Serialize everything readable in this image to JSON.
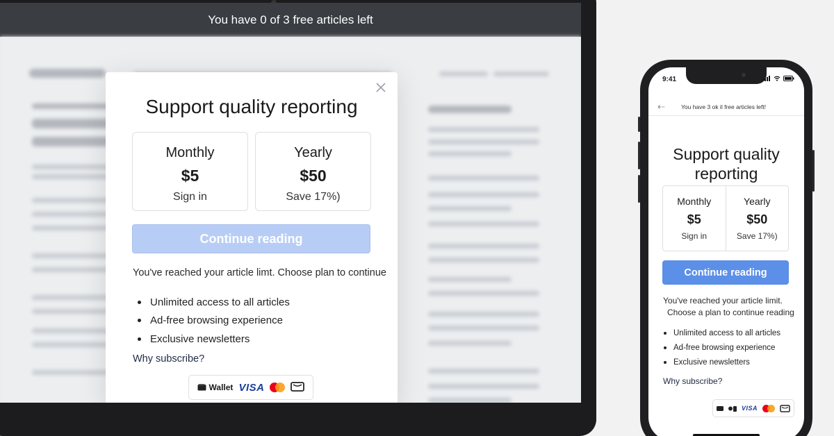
{
  "laptop": {
    "banner": "You have 0 of 3 free articles left",
    "modal": {
      "title": "Support quality reporting",
      "plans": [
        {
          "name": "Monthly",
          "price": "$5",
          "sub": "Sign in"
        },
        {
          "name": "Yearly",
          "price": "$50",
          "sub": "Save 17%)"
        }
      ],
      "cta": "Continue reading",
      "message": "You've reached your article limt. Choose plan to continue",
      "benefits": [
        "Unlimited access to all articles",
        "Ad-free browsing experience",
        "Exclusive newsletters"
      ],
      "why_link": "Why subscribe?",
      "payment": {
        "wallet": "Wallet",
        "visa": "VISA"
      }
    }
  },
  "phone": {
    "time": "9:41",
    "banner": "You have 3 ok il free articles left!",
    "title_line1": "Support quality",
    "title_line2": "reporting",
    "plans": [
      {
        "name": "Monthly",
        "price": "$5",
        "sub": "Sign in"
      },
      {
        "name": "Yearly",
        "price": "$50",
        "sub": "Save 17%)"
      }
    ],
    "cta": "Continue reading",
    "message_line1": "You've reached your article limit.",
    "message_line2": "Choose a plan to continue reading",
    "benefits": [
      "Unlimited access to all articles",
      "Ad-free browsing experience",
      "Exclusive newsletters"
    ],
    "why_link": "Why subscribe?",
    "payment": {
      "visa": "VISA"
    }
  },
  "colors": {
    "cta_disabled": "#b8cdf5",
    "cta_active": "#5b8fe8",
    "topbar": "#3a3d42",
    "visa": "#1a3e9a",
    "mastercard_red": "#eb001b",
    "mastercard_orange": "#f79e1b"
  },
  "icons": [
    "close-icon",
    "wallet-icon",
    "visa-icon",
    "mastercard-icon",
    "card-icon",
    "back-arrow-icon",
    "signal-icon",
    "wifi-icon",
    "battery-icon"
  ]
}
